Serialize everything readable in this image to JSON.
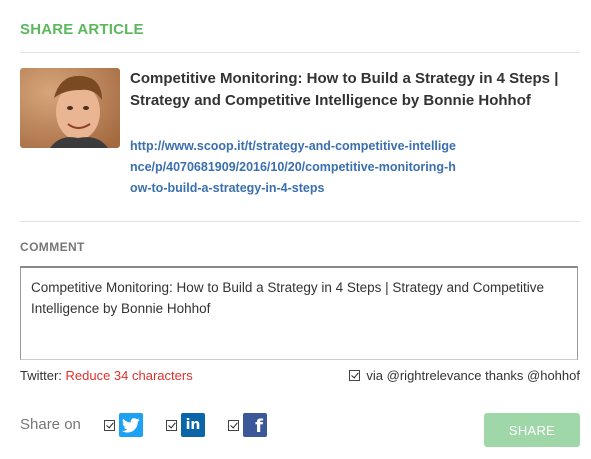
{
  "header": {
    "title": "SHARE ARTICLE"
  },
  "article": {
    "title": "Competitive Monitoring: How to Build a Strategy in 4 Steps | Strategy and Competitive Intelligence by Bonnie Hohhof",
    "url": "http://www.scoop.it/t/strategy-and-competitive-intelligence/p/4070681909/2016/10/20/competitive-monitoring-how-to-build-a-strategy-in-4-steps"
  },
  "comment": {
    "label": "COMMENT",
    "value": "Competitive Monitoring: How to Build a Strategy in 4 Steps | Strategy and Competitive Intelligence by Bonnie Hohhof"
  },
  "twitter": {
    "prefix": "Twitter: ",
    "warning": "Reduce 34 characters",
    "via_label": "via @rightrelevance thanks @hohhof"
  },
  "share_on": {
    "label": "Share on",
    "networks": [
      {
        "icon": "twitter-icon",
        "checked": true,
        "color": "#1da1f2"
      },
      {
        "icon": "linkedin-icon",
        "checked": true,
        "color": "#0a66a8",
        "glyph": "in"
      },
      {
        "icon": "facebook-icon",
        "checked": true,
        "color": "#3b5998",
        "glyph": "f"
      }
    ]
  },
  "actions": {
    "share_label": "SHARE"
  },
  "colors": {
    "accent": "#5bb85d",
    "link": "#3a6fb0",
    "warning": "#e0312f",
    "share_button": "#9fd7a8"
  }
}
